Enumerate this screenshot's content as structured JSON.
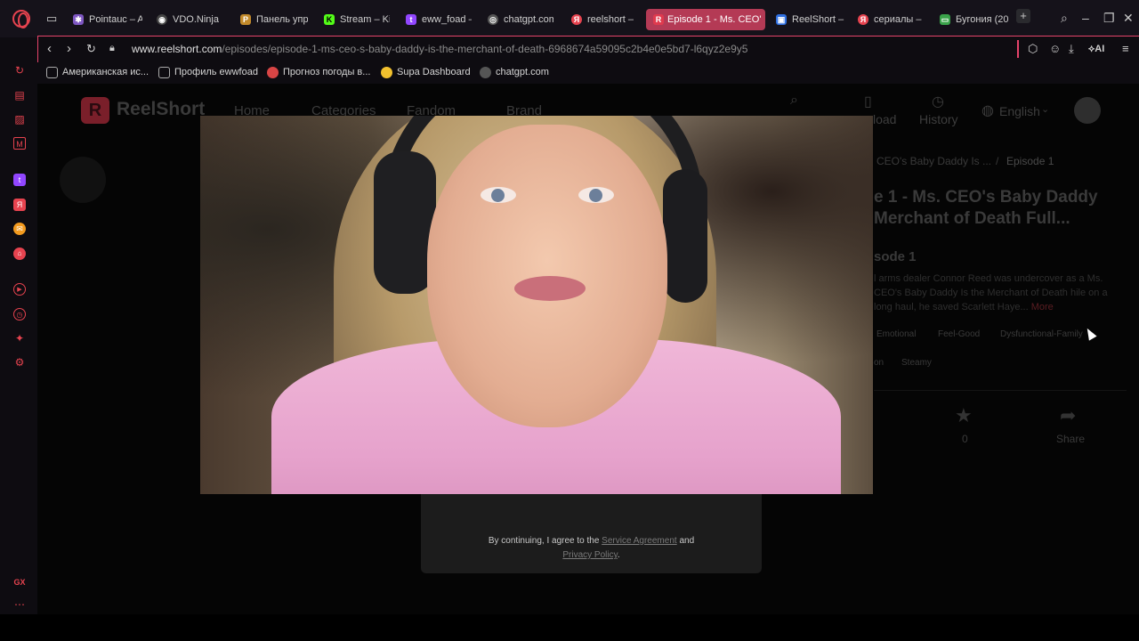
{
  "browser": {
    "tabs": [
      {
        "label": "Pointauc – A",
        "fav_color": "#7e57c2",
        "fav": "✱"
      },
      {
        "label": "VDO.Ninja",
        "fav_color": "#444",
        "fav": "◉"
      },
      {
        "label": "Панель упр",
        "fav_color": "#c28a2b",
        "fav": "Р"
      },
      {
        "label": "Stream – Kic",
        "fav_color": "#53fc18",
        "fav": "K"
      },
      {
        "label": "eww_foad –",
        "fav_color": "#9146ff",
        "fav": "t"
      },
      {
        "label": "chatgpt.com",
        "fav_color": "#555",
        "fav": "◎"
      },
      {
        "label": "reelshort –",
        "fav_color": "#e6434f",
        "fav": "Я"
      },
      {
        "label": "Episode 1 - Ms. CEO'",
        "fav_color": "#e03a4e",
        "fav": "R"
      },
      {
        "label": "ReelShort –",
        "fav_color": "#2f6fe0",
        "fav": "▣"
      },
      {
        "label": "сериалы –",
        "fav_color": "#e6434f",
        "fav": "Я"
      },
      {
        "label": "Бугония (20",
        "fav_color": "#3aa34a",
        "fav": "▭"
      }
    ],
    "url_domain": "www.reelshort.com",
    "url_path": "/episodes/episode-1-ms-ceo-s-baby-daddy-is-the-merchant-of-death-6968674a59095c2b4e0e5bd7-l6qyz2e9y5",
    "ai_label": "AI",
    "bookmarks": [
      {
        "label": "Американская ис...",
        "color": "#2a2a2a"
      },
      {
        "label": "Профиль ewwfoad",
        "color": "#2a2a2a"
      },
      {
        "label": "Прогноз погоды в...",
        "color": "#d84545"
      },
      {
        "label": "Supa Dashboard",
        "color": "#f2c12e"
      },
      {
        "label": "chatgpt.com",
        "color": "#555"
      }
    ],
    "sidebar_bottom_label": "GX"
  },
  "site": {
    "brand": "ReelShort",
    "nav": [
      "Home",
      "Categories",
      "Fandom",
      "Brand"
    ],
    "header_download": "load",
    "header_history": "History",
    "language": "English",
    "breadcrumb_series": "CEO's Baby Daddy Is ...",
    "breadcrumb_sep": "/",
    "breadcrumb_episode": "Episode 1",
    "episode_title": "e 1 - Ms. CEO's Baby Daddy Merchant of Death Full...",
    "episode_sub": "sode 1",
    "description": "l arms dealer Connor Reed was undercover as a Ms. CEO's Baby Daddy Is the Merchant of Death hile on a long haul, he saved Scarlett Haye...",
    "more": "More",
    "tags_row1": [
      "Emotional",
      "Feel-Good",
      "Dysfunctional-Family"
    ],
    "tags_row2": [
      "on",
      "Steamy"
    ],
    "like_count": "0",
    "share_label": "Share",
    "dialog": {
      "prefix": "By continuing, I agree to the",
      "service_agreement": "Service Agreement",
      "and": "and",
      "privacy_policy": "Privacy Policy",
      "period": "."
    }
  }
}
